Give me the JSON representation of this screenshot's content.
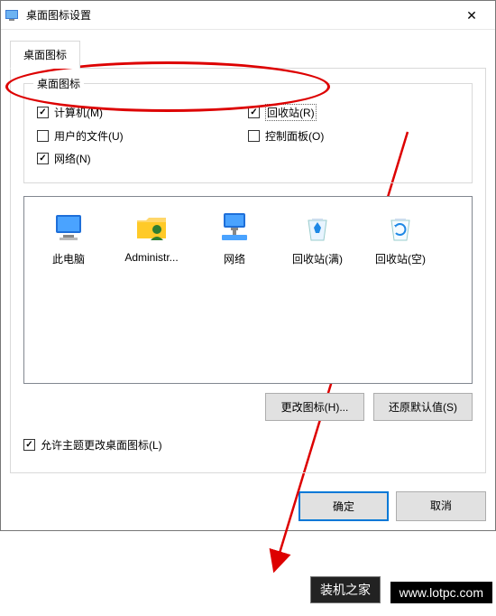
{
  "window": {
    "title": "桌面图标设置"
  },
  "tab": {
    "label": "桌面图标"
  },
  "group": {
    "legend": "桌面图标",
    "computer": "计算机(M)",
    "recycle": "回收站(R)",
    "userfiles": "用户的文件(U)",
    "controlpanel": "控制面板(O)",
    "network": "网络(N)"
  },
  "icons": {
    "thispc": "此电脑",
    "admin": "Administr...",
    "network": "网络",
    "recycle_full": "回收站(满)",
    "recycle_empty": "回收站(空)"
  },
  "buttons": {
    "change_icon": "更改图标(H)...",
    "restore_default": "还原默认值(S)",
    "allow_theme": "允许主题更改桌面图标(L)",
    "ok": "确定",
    "cancel": "取消"
  },
  "overlay": {
    "brand": "装机之家",
    "url": "www.lotpc.com"
  }
}
